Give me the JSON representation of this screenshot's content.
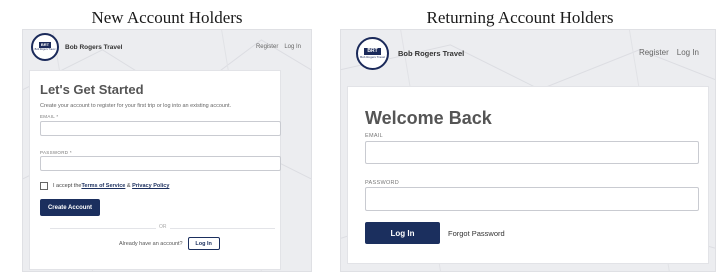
{
  "captions": {
    "left": "New Account Holders",
    "right": "Returning Account Holders"
  },
  "brand": {
    "name": "Bob Rogers Travel",
    "logo_mark": "BRT",
    "logo_sub": "Bob Rogers Travel"
  },
  "nav": {
    "register": "Register",
    "login": "Log In"
  },
  "signup": {
    "title": "Let's Get Started",
    "intro": "Create your account to register for your first trip or log into an existing account.",
    "email_label": "EMAIL *",
    "password_label": "PASSWORD *",
    "terms_prefix": "I accept the ",
    "terms_link": "Terms of Service",
    "terms_and": " & ",
    "privacy_link": "Privacy Policy",
    "create_button": "Create Account",
    "or_text": "OR",
    "have_account": "Already have an account?",
    "login_button": "Log In"
  },
  "login": {
    "title": "Welcome Back",
    "email_label": "EMAIL",
    "password_label": "PASSWORD",
    "login_button": "Log In",
    "forgot_link": "Forgot Password"
  },
  "colors": {
    "primary": "#1b2f5e",
    "panel_bg": "#ecedf0",
    "card_bg": "#ffffff"
  }
}
